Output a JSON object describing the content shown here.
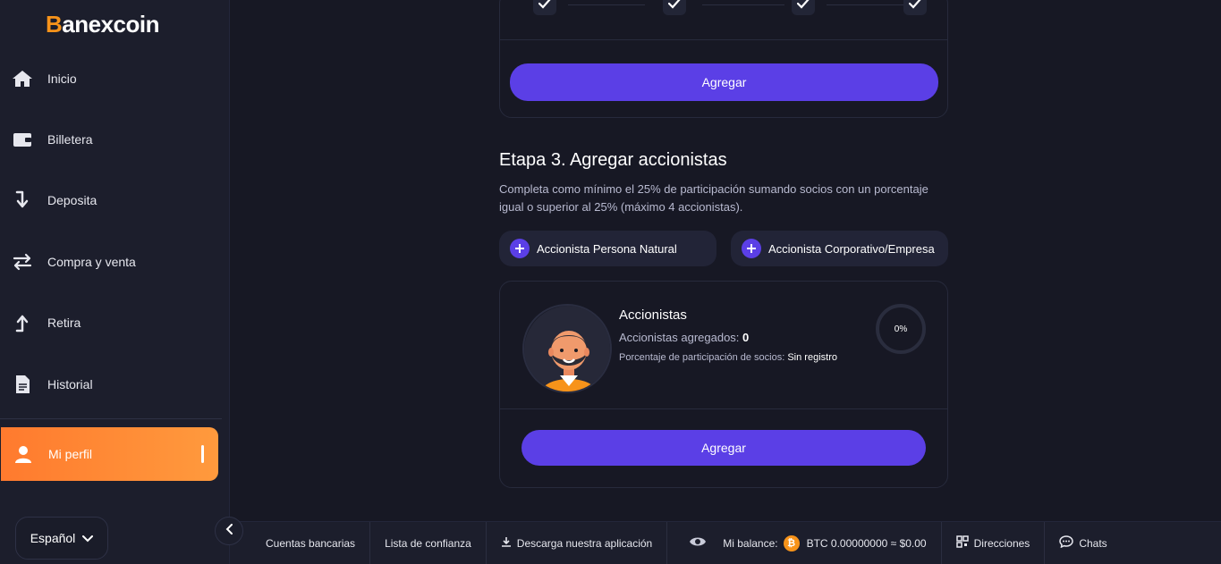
{
  "brand": {
    "name_first": "B",
    "name_rest": "anexcoin",
    "accent": "#f7931a"
  },
  "sidebar": {
    "items": [
      {
        "label": "Inicio",
        "icon": "home-icon"
      },
      {
        "label": "Billetera",
        "icon": "wallet-icon"
      },
      {
        "label": "Deposita",
        "icon": "arrow-down-icon"
      },
      {
        "label": "Compra y venta",
        "icon": "swap-icon"
      },
      {
        "label": "Retira",
        "icon": "arrow-up-icon"
      },
      {
        "label": "Historial",
        "icon": "document-icon"
      }
    ],
    "active": {
      "label": "Mi perfil",
      "icon": "user-icon"
    },
    "language": "Español"
  },
  "top_card": {
    "button_label": "Agregar"
  },
  "stage3": {
    "title": "Etapa 3. Agregar accionistas",
    "description": "Completa como mínimo el 25% de participación sumando socios con un porcentaje igual o superior al 25% (máximo 4 accionistas).",
    "add_natural": "Accionista Persona Natural",
    "add_corporate": "Accionista Corporativo/Empresa"
  },
  "shareholders": {
    "title": "Accionistas",
    "added_label": "Accionistas agregados:",
    "added_value": "0",
    "pct_label": "Porcentaje de participación de socios:",
    "pct_value": "Sin registro",
    "progress_text": "0%",
    "progress": 0,
    "button_label": "Agregar"
  },
  "bottom_bar": {
    "bank_accounts": "Cuentas bancarias",
    "trust_list": "Lista de confianza",
    "download_app": "Descarga nuestra aplicación",
    "balance_label": "Mi balance:",
    "balance_value": "BTC 0.00000000 ≈ $0.00",
    "addresses": "Direcciones",
    "chats": "Chats"
  }
}
